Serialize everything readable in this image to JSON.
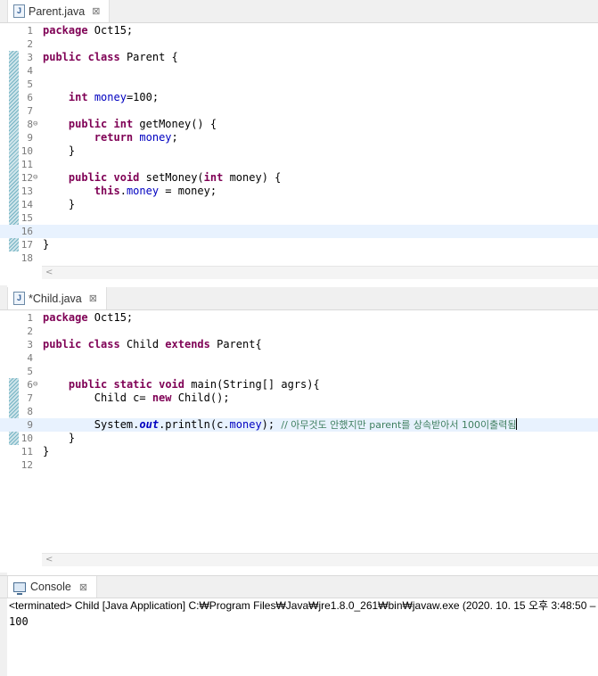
{
  "editor1": {
    "tab_label": "Parent.java",
    "tab_icon": "java-file-icon",
    "lines": [
      {
        "n": "1",
        "code": [
          {
            "t": "package",
            "c": "kw"
          },
          {
            "t": " Oct15;"
          }
        ]
      },
      {
        "n": "2",
        "code": []
      },
      {
        "n": "3",
        "code": [
          {
            "t": "public",
            "c": "kw"
          },
          {
            "t": " "
          },
          {
            "t": "class",
            "c": "kw"
          },
          {
            "t": " Parent {"
          }
        ]
      },
      {
        "n": "4",
        "code": []
      },
      {
        "n": "5",
        "code": []
      },
      {
        "n": "6",
        "code": [
          {
            "t": "    "
          },
          {
            "t": "int",
            "c": "kw"
          },
          {
            "t": " "
          },
          {
            "t": "money",
            "c": "fld"
          },
          {
            "t": "=100;"
          }
        ]
      },
      {
        "n": "7",
        "code": []
      },
      {
        "n": "8",
        "fold": "⊖",
        "code": [
          {
            "t": "    "
          },
          {
            "t": "public",
            "c": "kw"
          },
          {
            "t": " "
          },
          {
            "t": "int",
            "c": "kw"
          },
          {
            "t": " getMoney() {"
          }
        ]
      },
      {
        "n": "9",
        "code": [
          {
            "t": "        "
          },
          {
            "t": "return",
            "c": "kw"
          },
          {
            "t": " "
          },
          {
            "t": "money",
            "c": "fld"
          },
          {
            "t": ";"
          }
        ]
      },
      {
        "n": "10",
        "code": [
          {
            "t": "    }"
          }
        ]
      },
      {
        "n": "11",
        "code": []
      },
      {
        "n": "12",
        "fold": "⊖",
        "code": [
          {
            "t": "    "
          },
          {
            "t": "public",
            "c": "kw"
          },
          {
            "t": " "
          },
          {
            "t": "void",
            "c": "kw"
          },
          {
            "t": " setMoney("
          },
          {
            "t": "int",
            "c": "kw"
          },
          {
            "t": " money) {"
          }
        ]
      },
      {
        "n": "13",
        "code": [
          {
            "t": "        "
          },
          {
            "t": "this",
            "c": "kw"
          },
          {
            "t": "."
          },
          {
            "t": "money",
            "c": "fld"
          },
          {
            "t": " = money;"
          }
        ]
      },
      {
        "n": "14",
        "code": [
          {
            "t": "    }"
          }
        ]
      },
      {
        "n": "15",
        "code": []
      },
      {
        "n": "16",
        "hl": true,
        "code": []
      },
      {
        "n": "17",
        "code": [
          {
            "t": "}"
          }
        ]
      },
      {
        "n": "18",
        "code": []
      }
    ]
  },
  "editor2": {
    "tab_label": "*Child.java",
    "tab_icon": "java-file-icon",
    "lines": [
      {
        "n": "1",
        "code": [
          {
            "t": "package",
            "c": "kw"
          },
          {
            "t": " Oct15;"
          }
        ]
      },
      {
        "n": "2",
        "code": []
      },
      {
        "n": "3",
        "code": [
          {
            "t": "public",
            "c": "kw"
          },
          {
            "t": " "
          },
          {
            "t": "class",
            "c": "kw"
          },
          {
            "t": " Child "
          },
          {
            "t": "extends",
            "c": "kw"
          },
          {
            "t": " Parent{"
          }
        ]
      },
      {
        "n": "4",
        "code": []
      },
      {
        "n": "5",
        "code": []
      },
      {
        "n": "6",
        "fold": "⊖",
        "code": [
          {
            "t": "    "
          },
          {
            "t": "public",
            "c": "kw"
          },
          {
            "t": " "
          },
          {
            "t": "static",
            "c": "kw"
          },
          {
            "t": " "
          },
          {
            "t": "void",
            "c": "kw"
          },
          {
            "t": " main(String[] agrs){"
          }
        ]
      },
      {
        "n": "7",
        "code": [
          {
            "t": "        Child c= "
          },
          {
            "t": "new",
            "c": "kw"
          },
          {
            "t": " Child();"
          }
        ]
      },
      {
        "n": "8",
        "code": []
      },
      {
        "n": "9",
        "hl": true,
        "caret": true,
        "code": [
          {
            "t": "        System."
          },
          {
            "t": "out",
            "c": "stat"
          },
          {
            "t": ".println(c."
          },
          {
            "t": "money",
            "c": "fld"
          },
          {
            "t": "); "
          },
          {
            "t": "// 아무것도 안했지만 parent를 상속받아서 100이출력됨",
            "c": "cmt"
          }
        ]
      },
      {
        "n": "10",
        "code": [
          {
            "t": "    }"
          }
        ]
      },
      {
        "n": "11",
        "code": [
          {
            "t": "}"
          }
        ]
      },
      {
        "n": "12",
        "code": []
      }
    ]
  },
  "console": {
    "tab_label": "Console",
    "status": "<terminated> Child [Java Application] C:₩Program Files₩Java₩jre1.8.0_261₩bin₩javaw.exe  (2020. 10. 15 오후 3:48:50 –",
    "output": "100"
  }
}
